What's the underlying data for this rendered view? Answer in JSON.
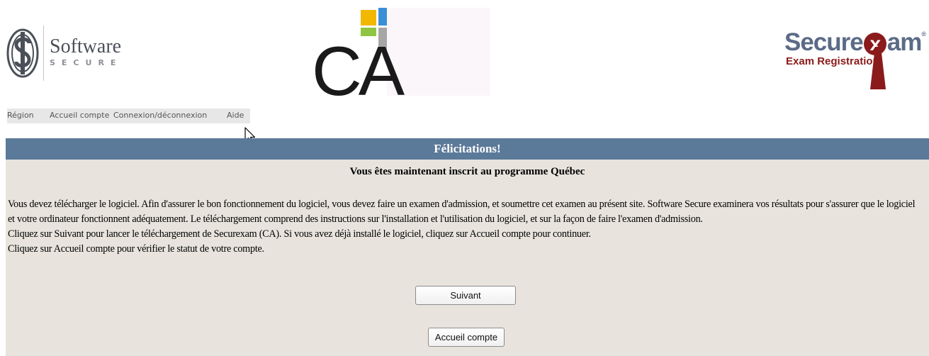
{
  "logos": {
    "software_secure": {
      "word": "Software",
      "sub": "SECURE",
      "icon": "software-secure-s-icon"
    },
    "ca": {
      "text": "CA"
    },
    "securexam": {
      "word_start": "Secure",
      "word_x": "x",
      "word_end": "am",
      "registered": "®",
      "sub": "Exam Registration"
    }
  },
  "nav": {
    "items": [
      {
        "label": "Région"
      },
      {
        "label": "Accueil compte"
      },
      {
        "label": "Connexion/déconnexion"
      },
      {
        "label": "Aide"
      }
    ]
  },
  "page": {
    "title": "Félicitations!",
    "subtitle": "Vous êtes maintenant inscrit au programme Québec",
    "paragraphs": [
      "Vous devez télécharger le logiciel. Afin d'assurer le bon fonctionnement du logiciel, vous devez faire un examen d'admission, et soumettre cet examen au présent site. Software Secure examinera vos résultats pour s'assurer que le logiciel et votre ordinateur fonctionnent adéquatement. Le téléchargement comprend des instructions sur l'installation et l'utilisation du logiciel, et sur la façon de faire l'examen d'admission.",
      "Cliquez sur Suivant pour lancer le téléchargement de Securexam (CA). Si vous avez déjà installé le logiciel, cliquez sur Accueil compte pour continuer.",
      "Cliquez sur Accueil compte pour vérifier le statut de votre compte."
    ],
    "buttons": {
      "next": "Suivant",
      "home": "Accueil compte"
    }
  },
  "colors": {
    "title_bar": "#5b7999",
    "content_bg": "#e8e4dd",
    "nav_bg": "#e7e7e7",
    "securexam_blue": "#5b6b86",
    "securexam_red": "#8b1a1a",
    "ca_yellow": "#f2b800",
    "ca_blue": "#3a8fd6",
    "ca_green": "#8fc641",
    "ca_gray": "#a6a6a6"
  }
}
